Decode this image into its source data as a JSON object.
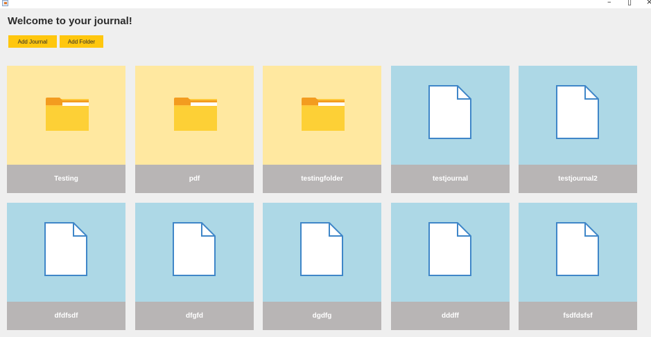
{
  "window": {
    "icons": {
      "app": "java-app-icon",
      "minimize": "minimize-icon",
      "maximize": "maximize-icon",
      "close": "close-icon"
    },
    "controls": {
      "minimize": "–",
      "maximize": "▯",
      "close": "×"
    }
  },
  "header": {
    "title": "Welcome to your journal!"
  },
  "toolbar": {
    "add_journal_label": "Add Journal",
    "add_folder_label": "Add Folder"
  },
  "colors": {
    "accent_button": "#ffc70e",
    "folder_tile": "#ffe8a0",
    "journal_tile": "#add8e6",
    "label_bar": "#b8b5b5"
  },
  "items": [
    {
      "type": "folder",
      "icon": "folder-icon",
      "name": "Testing"
    },
    {
      "type": "folder",
      "icon": "folder-icon",
      "name": "pdf"
    },
    {
      "type": "folder",
      "icon": "folder-icon",
      "name": "testingfolder"
    },
    {
      "type": "journal",
      "icon": "document-icon",
      "name": "testjournal"
    },
    {
      "type": "journal",
      "icon": "document-icon",
      "name": "testjournal2"
    },
    {
      "type": "journal",
      "icon": "document-icon",
      "name": "dfdfsdf"
    },
    {
      "type": "journal",
      "icon": "document-icon",
      "name": "dfgfd"
    },
    {
      "type": "journal",
      "icon": "document-icon",
      "name": "dgdfg"
    },
    {
      "type": "journal",
      "icon": "document-icon",
      "name": "dddff"
    },
    {
      "type": "journal",
      "icon": "document-icon",
      "name": "fsdfdsfsf"
    }
  ]
}
